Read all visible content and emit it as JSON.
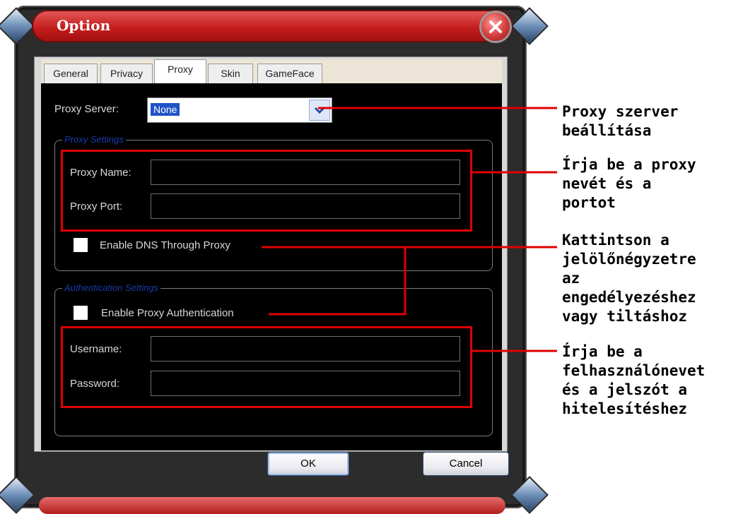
{
  "window": {
    "title": "Option"
  },
  "tabs": [
    {
      "label": "General",
      "active": false
    },
    {
      "label": "Privacy",
      "active": false
    },
    {
      "label": "Proxy",
      "active": true
    },
    {
      "label": "Skin",
      "active": false
    },
    {
      "label": "GameFace",
      "active": false
    }
  ],
  "proxy_server": {
    "label": "Proxy Server:",
    "value": "None"
  },
  "proxy_settings": {
    "legend": "Proxy Settings",
    "name_label": "Proxy Name:",
    "name_value": "",
    "port_label": "Proxy Port:",
    "port_value": "",
    "dns_label": "Enable DNS Through Proxy",
    "dns_checked": false
  },
  "auth_settings": {
    "legend": "Authentication Settings",
    "enable_label": "Enable Proxy Authentication",
    "enable_checked": false,
    "username_label": "Username:",
    "username_value": "",
    "password_label": "Password:",
    "password_value": ""
  },
  "buttons": {
    "ok": "OK",
    "cancel": "Cancel"
  },
  "annotations": {
    "proxy_server": [
      "Proxy szerver",
      "beállítása"
    ],
    "name_port": [
      "Írja be a proxy",
      "nevét és a",
      "portot"
    ],
    "checkboxes": [
      "Kattintson a",
      "jelölőnégyzetre",
      "az",
      "engedélyezéshez",
      "vagy tiltáshoz"
    ],
    "credentials": [
      "Írja be a",
      "felhasználónevet",
      "és a jelszót a",
      "hitelesítéshez"
    ]
  },
  "colors": {
    "accent_red": "#e00000",
    "title_red": "#c51d1d",
    "selection_blue": "#1f54c7",
    "legend_blue": "#1a3aaa"
  }
}
